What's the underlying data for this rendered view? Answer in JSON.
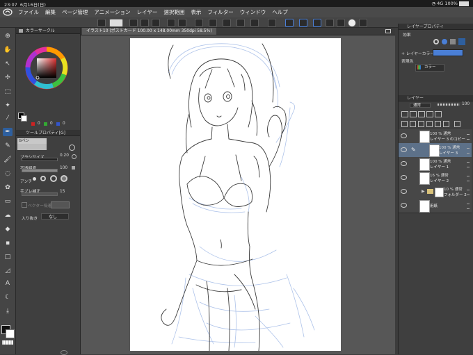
{
  "status": {
    "time": "23:07",
    "date": "6月16日(日)",
    "network": "4G",
    "battery": "100%"
  },
  "menu": [
    "ファイル",
    "編集",
    "ページ管理",
    "アニメーション",
    "レイヤー",
    "選択範囲",
    "表示",
    "フィルター",
    "ウィンドウ",
    "ヘルプ"
  ],
  "document_tab": "イラスト10 (ポストカード 100.00 x 148.00mm 350dpi 58.5%)",
  "color_panel": {
    "title": "カラーサークル"
  },
  "color_values": {
    "a": "0",
    "b": "0",
    "c": "0"
  },
  "tool_property": {
    "title": "ツールプロパティ[G]",
    "tool_name": "Gペン",
    "brush_size_label": "ブラシサイズ",
    "brush_size": "0.20",
    "opacity_label": "不透明度",
    "opacity": "100",
    "antialias_label": "アンチ",
    "stabilization_label": "手ブレ補正",
    "stabilization": "15",
    "vector_label": "ベクター吸着",
    "fade_label": "入り抜き",
    "fade_value": "なし"
  },
  "effect_panel": {
    "title": "効果"
  },
  "layer_property": {
    "title": "レイヤープロパティ",
    "layer_color_label": "レイヤーカラー",
    "expression_label": "表現色",
    "expression_value": "カラー"
  },
  "layer_panel": {
    "title": "レイヤー",
    "blend_mode": "通常",
    "opacity": "100",
    "layers": [
      {
        "info": "100 % 通常",
        "name": "レイヤー 3 のコピー",
        "selected": false
      },
      {
        "info": "100 % 通常",
        "name": "レイヤー 3",
        "selected": true
      },
      {
        "info": "100 % 通常",
        "name": "レイヤー 1",
        "selected": false
      },
      {
        "info": "16 % 通常",
        "name": "レイヤー 2",
        "selected": false
      },
      {
        "info": "10 % 通常",
        "name": "フォルダー 2",
        "selected": false
      },
      {
        "info": "",
        "name": "用紙",
        "selected": false
      }
    ]
  },
  "colors": {
    "accent": "#2e5f9e",
    "layer_color": "#4a7fd6",
    "selected_layer": "#5d7189"
  }
}
